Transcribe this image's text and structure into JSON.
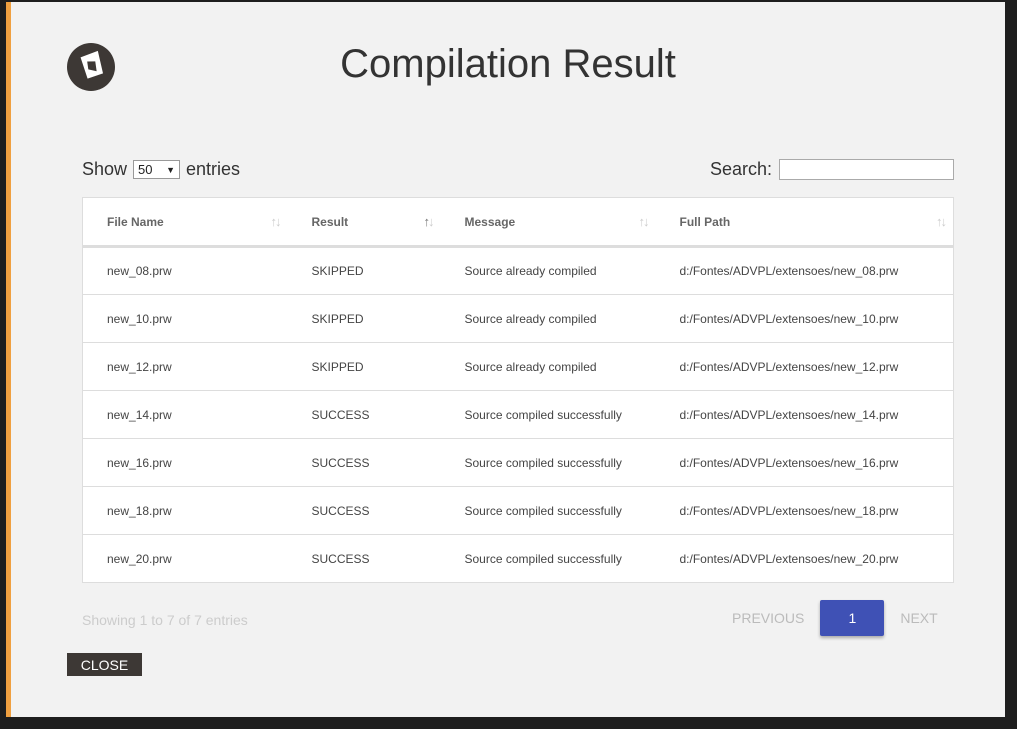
{
  "dialog": {
    "title": "Compilation Result",
    "accent_color": "#f0a040"
  },
  "length": {
    "show_label": "Show",
    "selected": "50",
    "entries_label": "entries"
  },
  "search": {
    "label": "Search:",
    "value": ""
  },
  "table": {
    "columns": [
      {
        "label": "File Name",
        "sorted": false
      },
      {
        "label": "Result",
        "sorted": true
      },
      {
        "label": "Message",
        "sorted": false
      },
      {
        "label": "Full Path",
        "sorted": false
      }
    ],
    "rows": [
      [
        "new_08.prw",
        "SKIPPED",
        "Source already compiled",
        "d:/Fontes/ADVPL/extensoes/new_08.prw"
      ],
      [
        "new_10.prw",
        "SKIPPED",
        "Source already compiled",
        "d:/Fontes/ADVPL/extensoes/new_10.prw"
      ],
      [
        "new_12.prw",
        "SKIPPED",
        "Source already compiled",
        "d:/Fontes/ADVPL/extensoes/new_12.prw"
      ],
      [
        "new_14.prw",
        "SUCCESS",
        "Source compiled successfully",
        "d:/Fontes/ADVPL/extensoes/new_14.prw"
      ],
      [
        "new_16.prw",
        "SUCCESS",
        "Source compiled successfully",
        "d:/Fontes/ADVPL/extensoes/new_16.prw"
      ],
      [
        "new_18.prw",
        "SUCCESS",
        "Source compiled successfully",
        "d:/Fontes/ADVPL/extensoes/new_18.prw"
      ],
      [
        "new_20.prw",
        "SUCCESS",
        "Source compiled successfully",
        "d:/Fontes/ADVPL/extensoes/new_20.prw"
      ]
    ]
  },
  "info": "Showing 1 to 7 of 7 entries",
  "pagination": {
    "previous": "PREVIOUS",
    "current": "1",
    "next": "NEXT",
    "active_color": "#3f51b5"
  },
  "close_label": "CLOSE"
}
